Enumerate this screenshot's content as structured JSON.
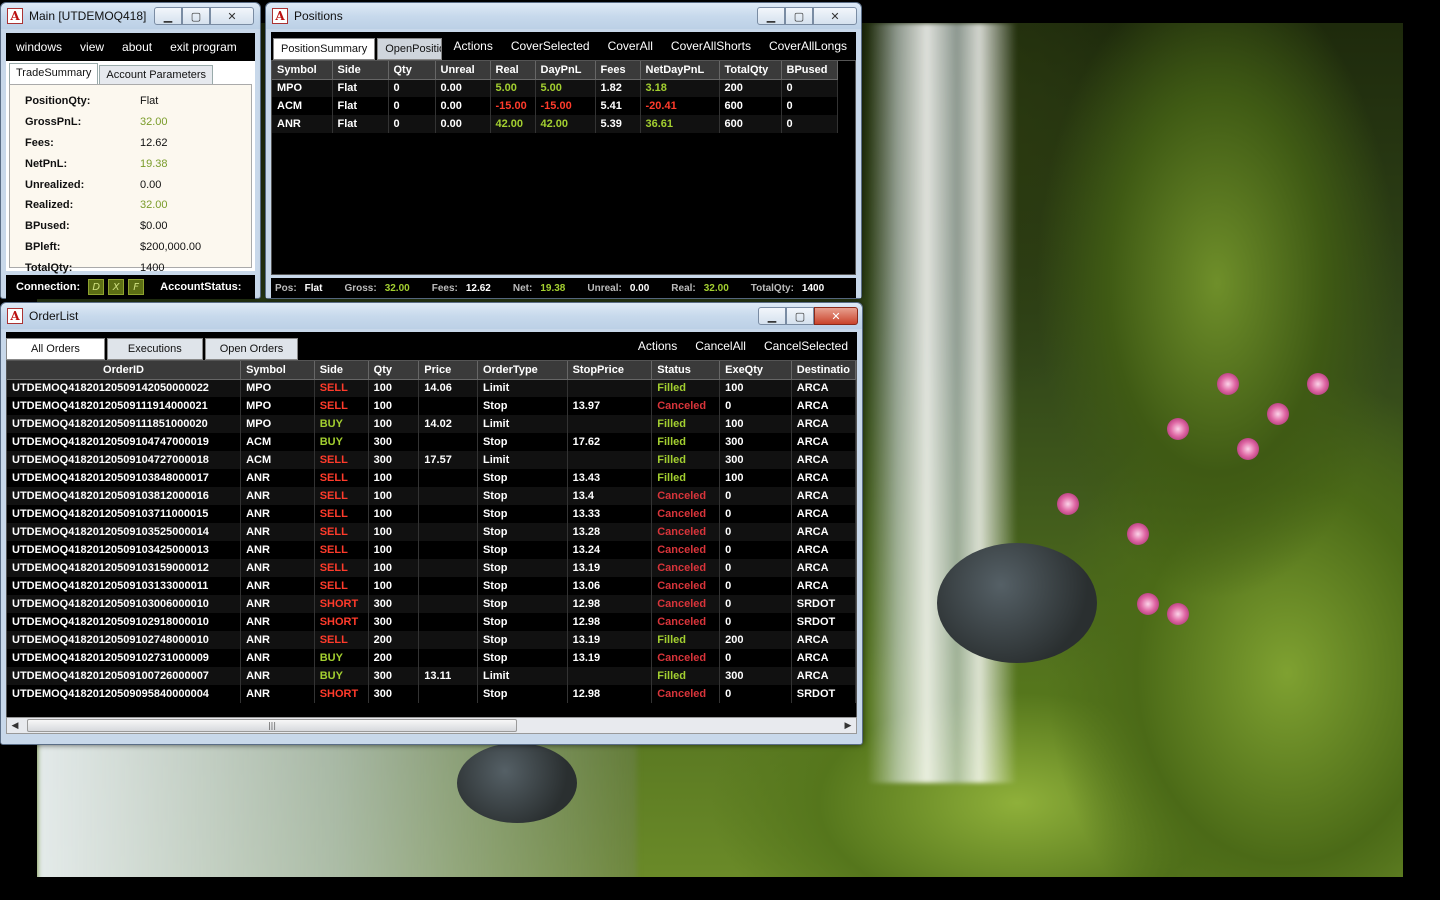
{
  "main": {
    "title": "Main [UTDEMOQ418]",
    "menu": [
      "windows",
      "view",
      "about",
      "exit program"
    ],
    "tabs": [
      "TradeSummary",
      "Account Parameters"
    ],
    "summary": [
      {
        "k": "PositionQty:",
        "v": "Flat",
        "c": ""
      },
      {
        "k": "GrossPnL:",
        "v": "32.00",
        "c": "green"
      },
      {
        "k": "Fees:",
        "v": "12.62",
        "c": ""
      },
      {
        "k": "NetPnL:",
        "v": "19.38",
        "c": "green"
      },
      {
        "k": "Unrealized:",
        "v": "0.00",
        "c": ""
      },
      {
        "k": "Realized:",
        "v": "32.00",
        "c": "green"
      },
      {
        "k": "BPused:",
        "v": "$0.00",
        "c": ""
      },
      {
        "k": "BPleft:",
        "v": "$200,000.00",
        "c": ""
      },
      {
        "k": "TotalQty:",
        "v": "1400",
        "c": ""
      }
    ],
    "connection_label": "Connection:",
    "leds": [
      "D",
      "X",
      "F"
    ],
    "account_status_label": "AccountStatus:"
  },
  "positions": {
    "title": "Positions",
    "tabs": [
      "PositionSummary",
      "OpenPositio"
    ],
    "actions": [
      "Actions",
      "CoverSelected",
      "CoverAll",
      "CoverAllShorts",
      "CoverAllLongs"
    ],
    "columns": [
      "Symbol",
      "Side",
      "Qty",
      "Unreal",
      "Real",
      "DayPnL",
      "Fees",
      "NetDayPnL",
      "TotalQty",
      "BPused"
    ],
    "rows": [
      [
        "MPO",
        "Flat",
        "0",
        "0.00",
        "5.00",
        "5.00",
        "1.82",
        "3.18",
        "200",
        "0"
      ],
      [
        "ACM",
        "Flat",
        "0",
        "0.00",
        "-15.00",
        "-15.00",
        "5.41",
        "-20.41",
        "600",
        "0"
      ],
      [
        "ANR",
        "Flat",
        "0",
        "0.00",
        "42.00",
        "42.00",
        "5.39",
        "36.61",
        "600",
        "0"
      ]
    ],
    "footer": [
      {
        "k": "Pos:",
        "v": "Flat",
        "c": ""
      },
      {
        "k": "Gross:",
        "v": "32.00",
        "c": "green"
      },
      {
        "k": "Fees:",
        "v": "12.62",
        "c": ""
      },
      {
        "k": "Net:",
        "v": "19.38",
        "c": "green"
      },
      {
        "k": "Unreal:",
        "v": "0.00",
        "c": ""
      },
      {
        "k": "Real:",
        "v": "32.00",
        "c": "green"
      },
      {
        "k": "TotalQty:",
        "v": "1400",
        "c": ""
      }
    ]
  },
  "orders": {
    "title": "OrderList",
    "tabs": [
      "All Orders",
      "Executions",
      "Open Orders"
    ],
    "actions": [
      "Actions",
      "CancelAll",
      "CancelSelected"
    ],
    "columns": [
      "OrderID",
      "Symbol",
      "Side",
      "Qty",
      "Price",
      "OrderType",
      "StopPrice",
      "Status",
      "ExeQty",
      "Destinatio"
    ],
    "rows": [
      [
        "UTDEMOQ41820120509142050000022",
        "MPO",
        "SELL",
        "100",
        "14.06",
        "Limit",
        "",
        "Filled",
        "100",
        "ARCA"
      ],
      [
        "UTDEMOQ41820120509111914000021",
        "MPO",
        "SELL",
        "100",
        "",
        "Stop",
        "13.97",
        "Canceled",
        "0",
        "ARCA"
      ],
      [
        "UTDEMOQ41820120509111851000020",
        "MPO",
        "BUY",
        "100",
        "14.02",
        "Limit",
        "",
        "Filled",
        "100",
        "ARCA"
      ],
      [
        "UTDEMOQ41820120509104747000019",
        "ACM",
        "BUY",
        "300",
        "",
        "Stop",
        "17.62",
        "Filled",
        "300",
        "ARCA"
      ],
      [
        "UTDEMOQ41820120509104727000018",
        "ACM",
        "SELL",
        "300",
        "17.57",
        "Limit",
        "",
        "Filled",
        "300",
        "ARCA"
      ],
      [
        "UTDEMOQ41820120509103848000017",
        "ANR",
        "SELL",
        "100",
        "",
        "Stop",
        "13.43",
        "Filled",
        "100",
        "ARCA"
      ],
      [
        "UTDEMOQ41820120509103812000016",
        "ANR",
        "SELL",
        "100",
        "",
        "Stop",
        "13.4",
        "Canceled",
        "0",
        "ARCA"
      ],
      [
        "UTDEMOQ41820120509103711000015",
        "ANR",
        "SELL",
        "100",
        "",
        "Stop",
        "13.33",
        "Canceled",
        "0",
        "ARCA"
      ],
      [
        "UTDEMOQ41820120509103525000014",
        "ANR",
        "SELL",
        "100",
        "",
        "Stop",
        "13.28",
        "Canceled",
        "0",
        "ARCA"
      ],
      [
        "UTDEMOQ41820120509103425000013",
        "ANR",
        "SELL",
        "100",
        "",
        "Stop",
        "13.24",
        "Canceled",
        "0",
        "ARCA"
      ],
      [
        "UTDEMOQ41820120509103159000012",
        "ANR",
        "SELL",
        "100",
        "",
        "Stop",
        "13.19",
        "Canceled",
        "0",
        "ARCA"
      ],
      [
        "UTDEMOQ41820120509103133000011",
        "ANR",
        "SELL",
        "100",
        "",
        "Stop",
        "13.06",
        "Canceled",
        "0",
        "ARCA"
      ],
      [
        "UTDEMOQ41820120509103006000010",
        "ANR",
        "SHORT",
        "300",
        "",
        "Stop",
        "12.98",
        "Canceled",
        "0",
        "SRDOT"
      ],
      [
        "UTDEMOQ41820120509102918000010",
        "ANR",
        "SHORT",
        "300",
        "",
        "Stop",
        "12.98",
        "Canceled",
        "0",
        "SRDOT"
      ],
      [
        "UTDEMOQ41820120509102748000010",
        "ANR",
        "SELL",
        "200",
        "",
        "Stop",
        "13.19",
        "Filled",
        "200",
        "ARCA"
      ],
      [
        "UTDEMOQ41820120509102731000009",
        "ANR",
        "BUY",
        "200",
        "",
        "Stop",
        "13.19",
        "Canceled",
        "0",
        "ARCA"
      ],
      [
        "UTDEMOQ41820120509100726000007",
        "ANR",
        "BUY",
        "300",
        "13.11",
        "Limit",
        "",
        "Filled",
        "300",
        "ARCA"
      ],
      [
        "UTDEMOQ41820120509095840000004",
        "ANR",
        "SHORT",
        "300",
        "",
        "Stop",
        "12.98",
        "Canceled",
        "0",
        "SRDOT"
      ]
    ]
  },
  "colors": {
    "positive": "#a3cf30",
    "negative": "#ff3b2b",
    "canceled": "#d8343a",
    "sell": "#ff3b2b",
    "buy": "#a3cf30"
  }
}
